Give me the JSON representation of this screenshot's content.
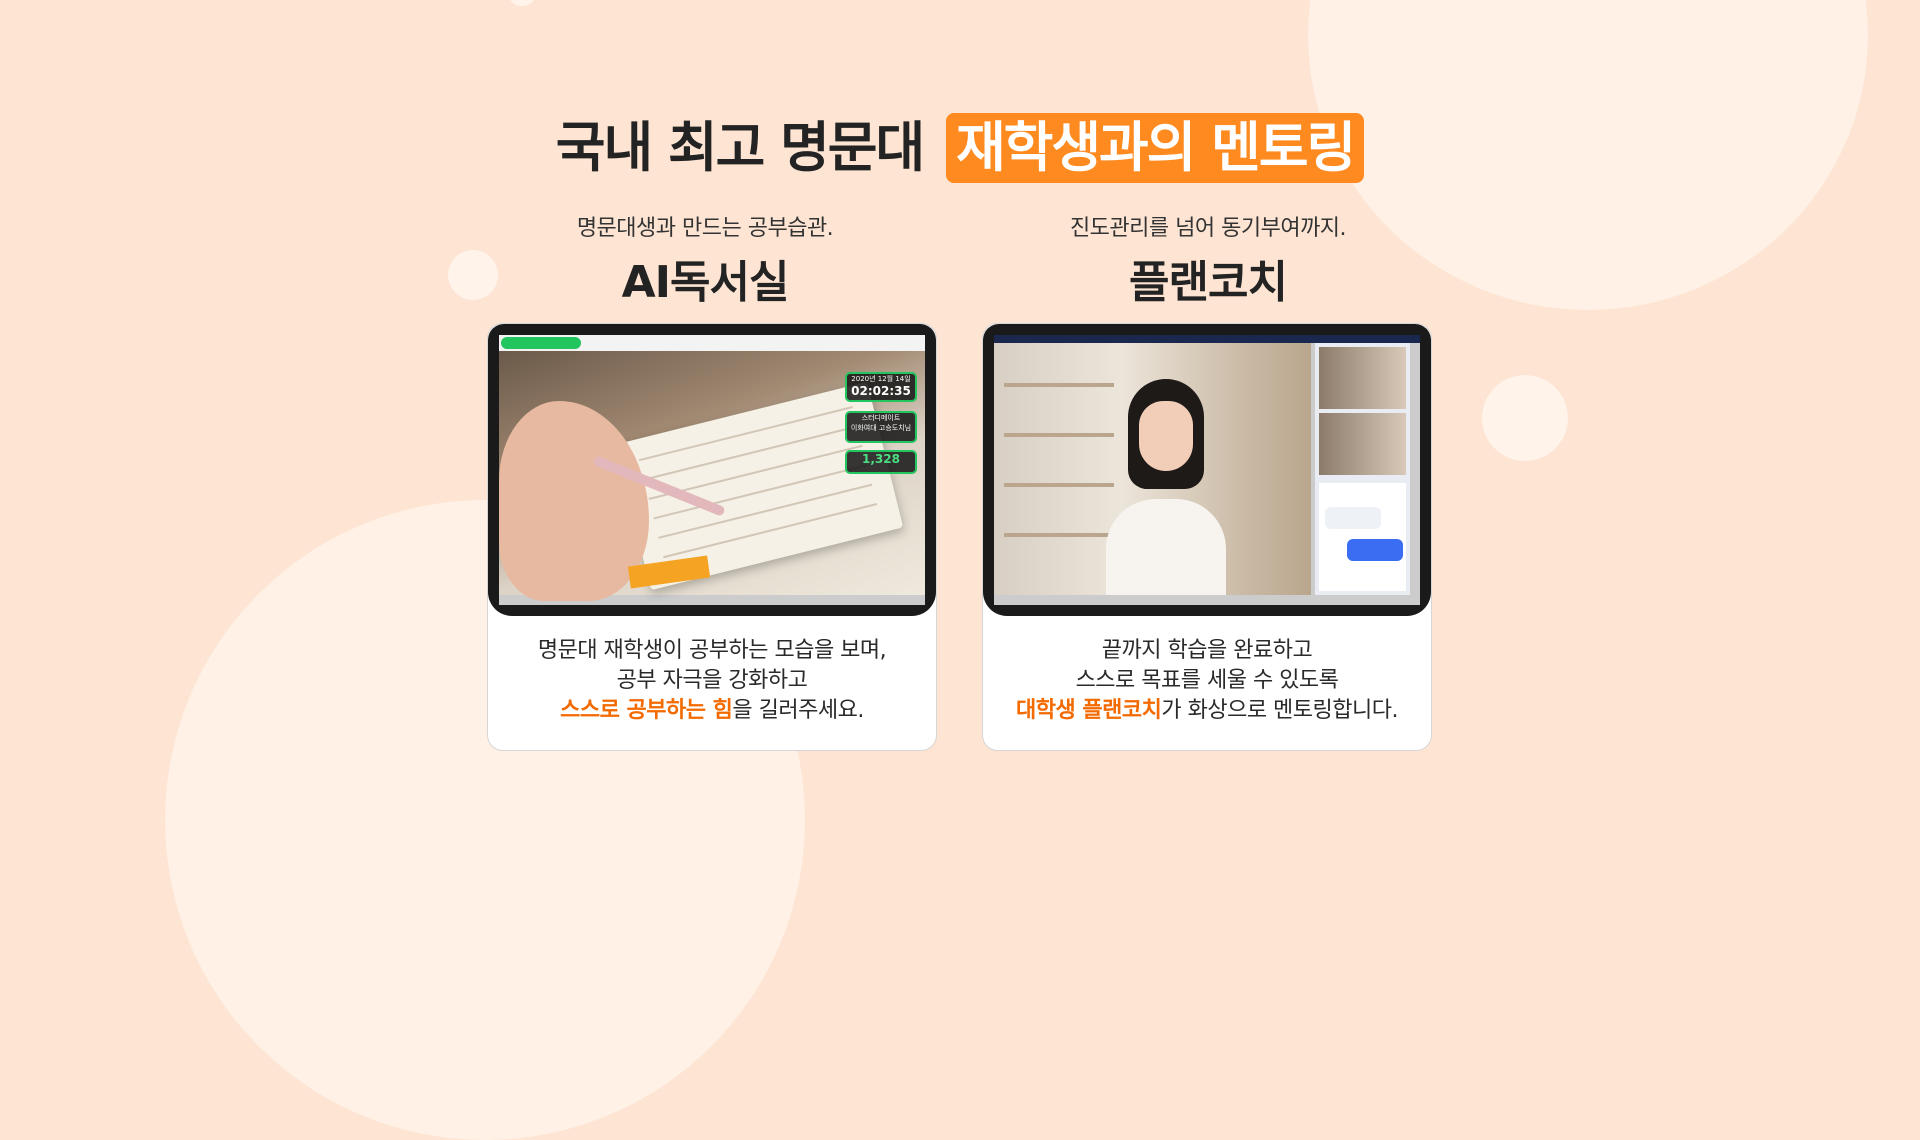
{
  "headline": {
    "prefix": "국내 최고 명문대",
    "highlight": "재학생과의 멘토링"
  },
  "left": {
    "subtitle": "명문대생과 만드는 공부습관.",
    "name": "AI독서실",
    "screen": {
      "date": "2020년 12월 14일",
      "time": "02:02:35",
      "badge": "스터디메이트",
      "university": "이화여대 고승도치님",
      "count": "1,328"
    },
    "desc_line1": "명문대 재학생이 공부하는 모습을 보며,",
    "desc_line2": "공부 자극을 강화하고",
    "desc_line3_highlight": "스스로 공부하는 힘",
    "desc_line3_rest": "을 길러주세요."
  },
  "right": {
    "subtitle": "진도관리를 넘어 동기부여까지.",
    "name": "플랜코치",
    "desc_line1": "끝까지 학습을 완료하고",
    "desc_line2": "스스로 목표를 세울 수 있도록",
    "desc_line3_highlight": "대학생 플랜코치",
    "desc_line3_rest": "가 화상으로 멘토링합니다."
  },
  "colors": {
    "background": "#fde4d3",
    "accent_orange": "#ff8a1f",
    "text_orange": "#f26a00",
    "green": "#22c55e"
  }
}
